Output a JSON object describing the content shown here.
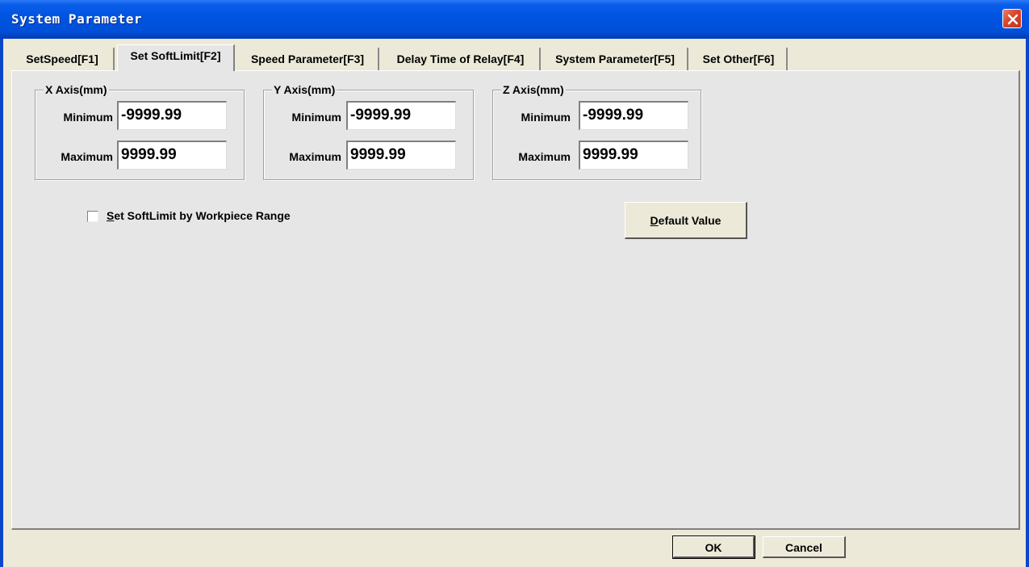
{
  "window": {
    "title": "System Parameter"
  },
  "tabs": [
    {
      "label": "SetSpeed[F1]"
    },
    {
      "label": "Set SoftLimit[F2]"
    },
    {
      "label": "Speed Parameter[F3]"
    },
    {
      "label": "Delay Time of Relay[F4]"
    },
    {
      "label": "System Parameter[F5]"
    },
    {
      "label": "Set Other[F6]"
    }
  ],
  "active_tab": "Set SoftLimit[F2]",
  "axes": [
    {
      "title": "X Axis(mm)",
      "min_label": "Minimum",
      "min_value": "-9999.99",
      "max_label": "Maximum",
      "max_value": "9999.99"
    },
    {
      "title": "Y Axis(mm)",
      "min_label": "Minimum",
      "min_value": "-9999.99",
      "max_label": "Maximum",
      "max_value": "9999.99"
    },
    {
      "title": "Z Axis(mm)",
      "min_label": "Minimum",
      "min_value": "-9999.99",
      "max_label": "Maximum",
      "max_value": "9999.99"
    }
  ],
  "workpiece_option": {
    "accel": "S",
    "label_rest": "et SoftLimit by Workpiece Range",
    "checked": false
  },
  "default_button": {
    "accel": "D",
    "label_rest": "efault Value"
  },
  "footer": {
    "ok_label": "OK",
    "cancel_label": "Cancel"
  },
  "colors": {
    "titlebar": "#0054E3",
    "panel": "#E6E6E6",
    "dialog": "#ECE9D8",
    "close_button": "#D9452B"
  }
}
